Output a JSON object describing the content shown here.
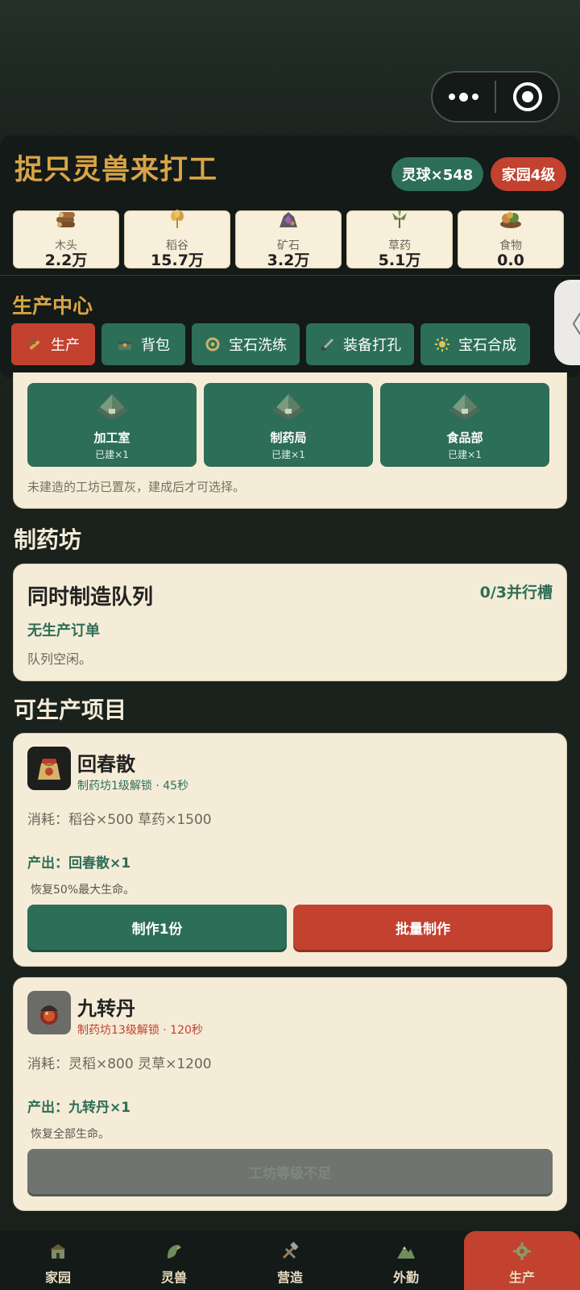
{
  "header": {
    "title": "捉只灵兽来打工",
    "spirit_orbs": "灵球×548",
    "home_level": "家园4级"
  },
  "resources": [
    {
      "label": "木头",
      "value": "2.2万",
      "icon": "wood-icon"
    },
    {
      "label": "稻谷",
      "value": "15.7万",
      "icon": "grain-icon"
    },
    {
      "label": "矿石",
      "value": "3.2万",
      "icon": "ore-icon"
    },
    {
      "label": "草药",
      "value": "5.1万",
      "icon": "herb-icon"
    },
    {
      "label": "食物",
      "value": "0.0",
      "icon": "food-icon"
    }
  ],
  "production_center": {
    "title": "生产中心",
    "tabs": [
      {
        "label": "生产",
        "active": true
      },
      {
        "label": "背包"
      },
      {
        "label": "宝石洗练"
      },
      {
        "label": "装备打孔"
      },
      {
        "label": "宝石合成"
      }
    ]
  },
  "side_handle": "〈",
  "workshops": {
    "items": [
      {
        "name": "加工室",
        "count": "已建×1"
      },
      {
        "name": "制药局",
        "count": "已建×1"
      },
      {
        "name": "食品部",
        "count": "已建×1"
      }
    ],
    "note": "未建造的工坊已置灰，建成后才可选择。"
  },
  "section_pharmacy": "制药坊",
  "queue": {
    "title": "同时制造队列",
    "slots": "0/3并行槽",
    "empty_label": "无生产订单",
    "idle_text": "队列空闲。"
  },
  "section_products": "可生产项目",
  "products": [
    {
      "name": "回春散",
      "unlock": "制药坊1级解锁 · 45秒",
      "cost": "消耗：稻谷×500  草药×1500",
      "output": "产出：回春散×1",
      "desc": "恢复50%最大生命。",
      "btn_make_one": "制作1份",
      "btn_batch": "批量制作"
    },
    {
      "name": "九转丹",
      "unlock": "制药坊13级解锁 · 120秒",
      "cost": "消耗：灵稻×800  灵草×1200",
      "output": "产出：九转丹×1",
      "desc": "恢复全部生命。",
      "btn_locked": "工坊等级不足"
    }
  ],
  "nav": [
    {
      "label": "家园"
    },
    {
      "label": "灵兽"
    },
    {
      "label": "营造"
    },
    {
      "label": "外勤"
    },
    {
      "label": "生产",
      "active": true
    }
  ],
  "colors": {
    "accent_green": "#2d6e58",
    "accent_red": "#c2412f",
    "gold_title": "#d9a447",
    "card_bg": "#f5ecd7"
  }
}
